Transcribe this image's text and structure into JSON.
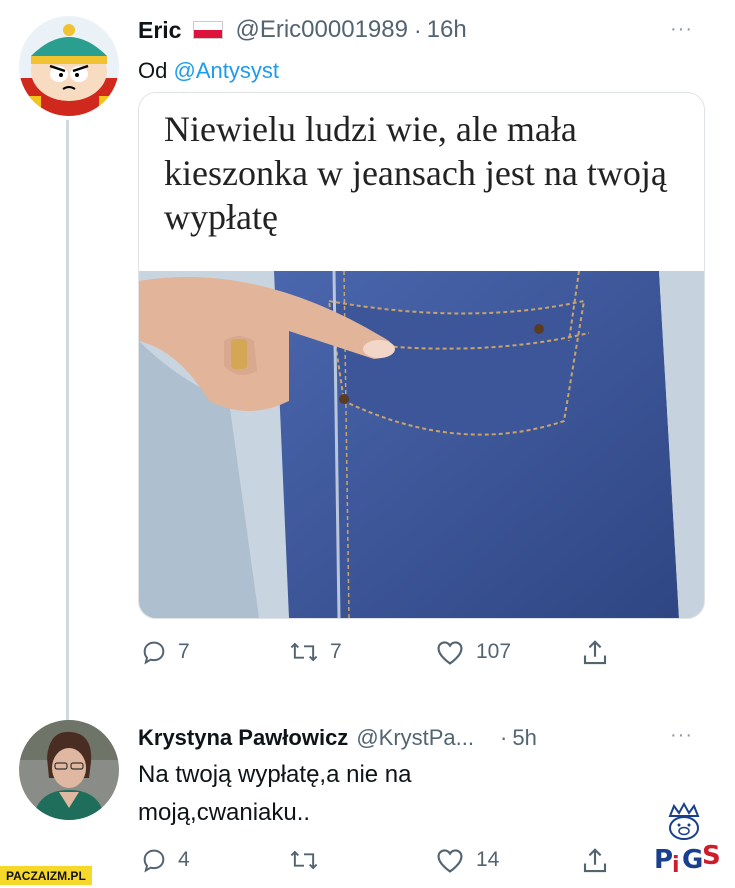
{
  "tweet1": {
    "display_name": "Eric",
    "flag": "PL",
    "handle": "@Eric00001989",
    "separator": "·",
    "time": "16h",
    "more": "···",
    "reply_prefix": "Od",
    "reply_to": "@Antysyst",
    "media_caption": "Niewielu ludzi wie, ale mała kieszonka w jeansach jest na twoją wypłatę",
    "stats": {
      "replies": "7",
      "retweets": "7",
      "likes": "107"
    }
  },
  "tweet2": {
    "display_name": "Krystyna Pawłowicz",
    "handle": "@KrystPa...",
    "separator": "·",
    "time": "5h",
    "more": "···",
    "text_line1": "Na twoją wypłatę,a nie na",
    "text_line2": "moją,cwaniaku..",
    "stats": {
      "replies": "4",
      "retweets": "",
      "likes": "14"
    }
  },
  "watermark": "PACZAIZM.PL",
  "logo_text": "PiGS",
  "colors": {
    "link": "#1d9bf0",
    "muted": "#536471",
    "jeans": "#3f5a9e",
    "flag_red": "#dc143c"
  }
}
